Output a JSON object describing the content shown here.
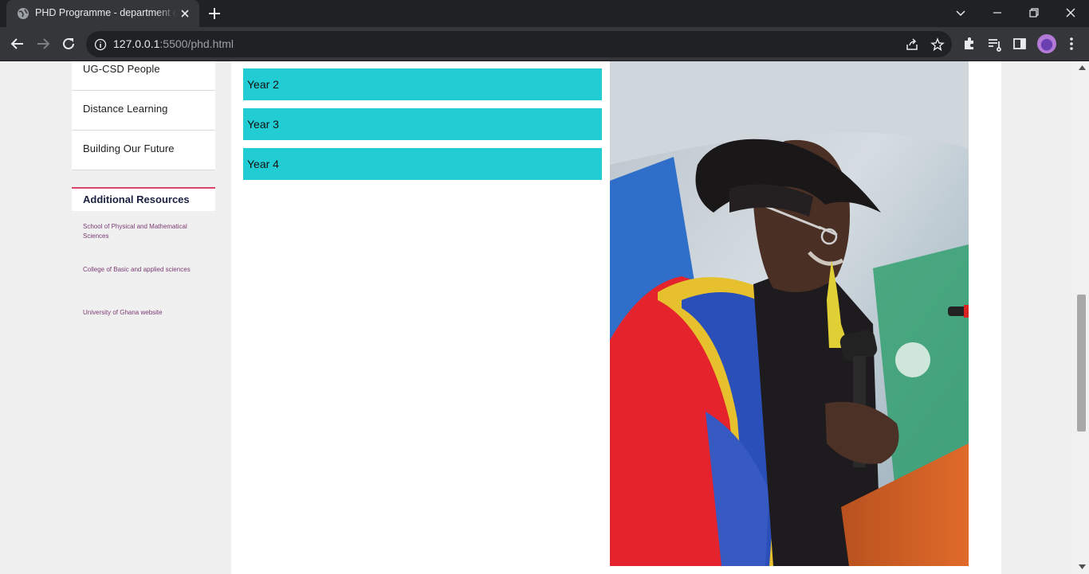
{
  "browser": {
    "tab_title": "PHD Programme - department of Computer Science",
    "url_host": "127.0.0.1",
    "url_path": ":5500/phd.html"
  },
  "sidebar": {
    "items": [
      {
        "label": "UG-CSD People"
      },
      {
        "label": "Distance Learning"
      },
      {
        "label": "Building Our Future"
      }
    ],
    "resources_heading": "Additional Resources",
    "resources": [
      {
        "label": "School of Physical and Mathematical Sciences"
      },
      {
        "label": "College of Basic and applied sciences"
      },
      {
        "label": "University of Ghana website"
      }
    ]
  },
  "accordion": {
    "years": [
      {
        "label": "Year 2"
      },
      {
        "label": "Year 3"
      },
      {
        "label": "Year 4"
      }
    ]
  },
  "colors": {
    "accordion_bar": "#22ccd3",
    "resources_accent": "#d7446a",
    "resource_link": "#7a3b73"
  }
}
